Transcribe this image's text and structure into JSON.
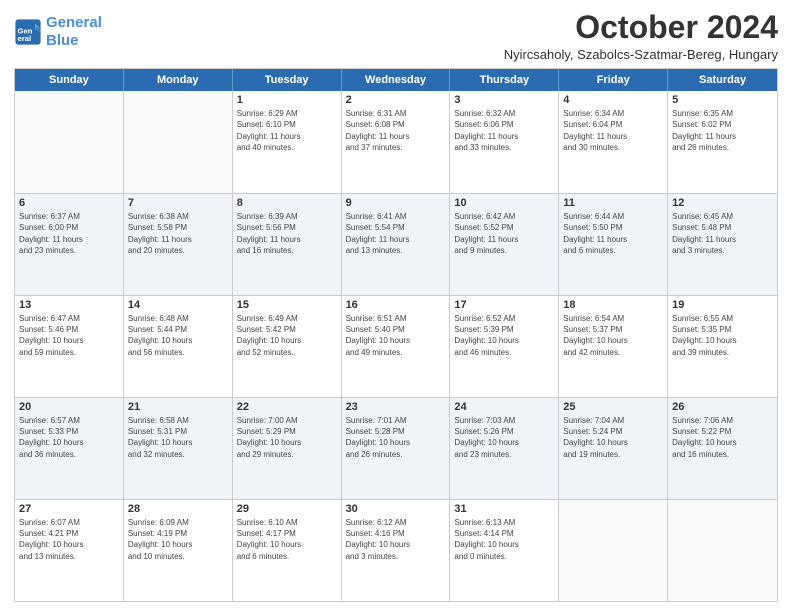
{
  "header": {
    "logo_line1": "General",
    "logo_line2": "Blue",
    "month_title": "October 2024",
    "location": "Nyircsaholy, Szabolcs-Szatmar-Bereg, Hungary"
  },
  "weekdays": [
    "Sunday",
    "Monday",
    "Tuesday",
    "Wednesday",
    "Thursday",
    "Friday",
    "Saturday"
  ],
  "weeks": [
    [
      {
        "day": "",
        "empty": true
      },
      {
        "day": "",
        "empty": true
      },
      {
        "day": "1",
        "info": "Sunrise: 6:29 AM\nSunset: 6:10 PM\nDaylight: 11 hours\nand 40 minutes."
      },
      {
        "day": "2",
        "info": "Sunrise: 6:31 AM\nSunset: 6:08 PM\nDaylight: 11 hours\nand 37 minutes."
      },
      {
        "day": "3",
        "info": "Sunrise: 6:32 AM\nSunset: 6:06 PM\nDaylight: 11 hours\nand 33 minutes."
      },
      {
        "day": "4",
        "info": "Sunrise: 6:34 AM\nSunset: 6:04 PM\nDaylight: 11 hours\nand 30 minutes."
      },
      {
        "day": "5",
        "info": "Sunrise: 6:35 AM\nSunset: 6:02 PM\nDaylight: 11 hours\nand 26 minutes."
      }
    ],
    [
      {
        "day": "6",
        "info": "Sunrise: 6:37 AM\nSunset: 6:00 PM\nDaylight: 11 hours\nand 23 minutes."
      },
      {
        "day": "7",
        "info": "Sunrise: 6:38 AM\nSunset: 5:58 PM\nDaylight: 11 hours\nand 20 minutes."
      },
      {
        "day": "8",
        "info": "Sunrise: 6:39 AM\nSunset: 5:56 PM\nDaylight: 11 hours\nand 16 minutes."
      },
      {
        "day": "9",
        "info": "Sunrise: 6:41 AM\nSunset: 5:54 PM\nDaylight: 11 hours\nand 13 minutes."
      },
      {
        "day": "10",
        "info": "Sunrise: 6:42 AM\nSunset: 5:52 PM\nDaylight: 11 hours\nand 9 minutes."
      },
      {
        "day": "11",
        "info": "Sunrise: 6:44 AM\nSunset: 5:50 PM\nDaylight: 11 hours\nand 6 minutes."
      },
      {
        "day": "12",
        "info": "Sunrise: 6:45 AM\nSunset: 5:48 PM\nDaylight: 11 hours\nand 3 minutes."
      }
    ],
    [
      {
        "day": "13",
        "info": "Sunrise: 6:47 AM\nSunset: 5:46 PM\nDaylight: 10 hours\nand 59 minutes."
      },
      {
        "day": "14",
        "info": "Sunrise: 6:48 AM\nSunset: 5:44 PM\nDaylight: 10 hours\nand 56 minutes."
      },
      {
        "day": "15",
        "info": "Sunrise: 6:49 AM\nSunset: 5:42 PM\nDaylight: 10 hours\nand 52 minutes."
      },
      {
        "day": "16",
        "info": "Sunrise: 6:51 AM\nSunset: 5:40 PM\nDaylight: 10 hours\nand 49 minutes."
      },
      {
        "day": "17",
        "info": "Sunrise: 6:52 AM\nSunset: 5:39 PM\nDaylight: 10 hours\nand 46 minutes."
      },
      {
        "day": "18",
        "info": "Sunrise: 6:54 AM\nSunset: 5:37 PM\nDaylight: 10 hours\nand 42 minutes."
      },
      {
        "day": "19",
        "info": "Sunrise: 6:55 AM\nSunset: 5:35 PM\nDaylight: 10 hours\nand 39 minutes."
      }
    ],
    [
      {
        "day": "20",
        "info": "Sunrise: 6:57 AM\nSunset: 5:33 PM\nDaylight: 10 hours\nand 36 minutes."
      },
      {
        "day": "21",
        "info": "Sunrise: 6:58 AM\nSunset: 5:31 PM\nDaylight: 10 hours\nand 32 minutes."
      },
      {
        "day": "22",
        "info": "Sunrise: 7:00 AM\nSunset: 5:29 PM\nDaylight: 10 hours\nand 29 minutes."
      },
      {
        "day": "23",
        "info": "Sunrise: 7:01 AM\nSunset: 5:28 PM\nDaylight: 10 hours\nand 26 minutes."
      },
      {
        "day": "24",
        "info": "Sunrise: 7:03 AM\nSunset: 5:26 PM\nDaylight: 10 hours\nand 23 minutes."
      },
      {
        "day": "25",
        "info": "Sunrise: 7:04 AM\nSunset: 5:24 PM\nDaylight: 10 hours\nand 19 minutes."
      },
      {
        "day": "26",
        "info": "Sunrise: 7:06 AM\nSunset: 5:22 PM\nDaylight: 10 hours\nand 16 minutes."
      }
    ],
    [
      {
        "day": "27",
        "info": "Sunrise: 6:07 AM\nSunset: 4:21 PM\nDaylight: 10 hours\nand 13 minutes."
      },
      {
        "day": "28",
        "info": "Sunrise: 6:09 AM\nSunset: 4:19 PM\nDaylight: 10 hours\nand 10 minutes."
      },
      {
        "day": "29",
        "info": "Sunrise: 6:10 AM\nSunset: 4:17 PM\nDaylight: 10 hours\nand 6 minutes."
      },
      {
        "day": "30",
        "info": "Sunrise: 6:12 AM\nSunset: 4:16 PM\nDaylight: 10 hours\nand 3 minutes."
      },
      {
        "day": "31",
        "info": "Sunrise: 6:13 AM\nSunset: 4:14 PM\nDaylight: 10 hours\nand 0 minutes."
      },
      {
        "day": "",
        "empty": true
      },
      {
        "day": "",
        "empty": true
      }
    ]
  ]
}
